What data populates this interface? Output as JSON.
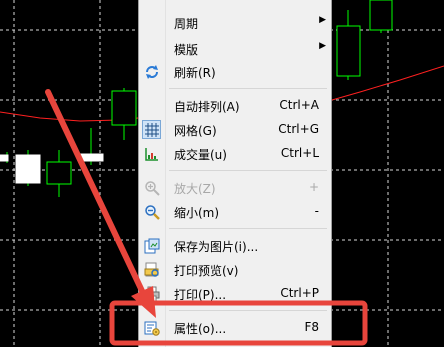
{
  "menu": {
    "items": [
      {
        "label": "周期",
        "shortcut": "",
        "submenu": true,
        "icon": "",
        "disabled": false
      },
      {
        "label": "模版",
        "shortcut": "",
        "submenu": true,
        "icon": "",
        "disabled": false
      },
      {
        "label": "刷新(R)",
        "shortcut": "",
        "submenu": false,
        "icon": "refresh-icon",
        "disabled": false
      },
      {
        "label": "自动排列(A)",
        "shortcut": "Ctrl+A",
        "submenu": false,
        "icon": "",
        "disabled": false
      },
      {
        "label": "网格(G)",
        "shortcut": "Ctrl+G",
        "submenu": false,
        "icon": "grid-icon",
        "disabled": false,
        "checked": true
      },
      {
        "label": "成交量(u)",
        "shortcut": "Ctrl+L",
        "submenu": false,
        "icon": "volume-icon",
        "disabled": false
      },
      {
        "label": "放大(Z)",
        "shortcut": "+",
        "submenu": false,
        "icon": "zoom-in-icon",
        "disabled": true
      },
      {
        "label": "缩小(m)",
        "shortcut": "-",
        "submenu": false,
        "icon": "zoom-out-icon",
        "disabled": false
      },
      {
        "label": "保存为图片(i)...",
        "shortcut": "",
        "submenu": false,
        "icon": "save-image-icon",
        "disabled": false
      },
      {
        "label": "打印预览(v)",
        "shortcut": "",
        "submenu": false,
        "icon": "print-preview-icon",
        "disabled": false
      },
      {
        "label": "打印(P)...",
        "shortcut": "Ctrl+P",
        "submenu": false,
        "icon": "print-icon",
        "disabled": false
      },
      {
        "label": "属性(o)...",
        "shortcut": "F8",
        "submenu": false,
        "icon": "properties-icon",
        "disabled": false
      }
    ]
  },
  "annotation": {
    "color": "#e8453c"
  },
  "chart": {
    "background": "#000000",
    "candle_color": "#00ff00",
    "ma_color": "#ff2020",
    "grid_color": "#ffffff"
  }
}
